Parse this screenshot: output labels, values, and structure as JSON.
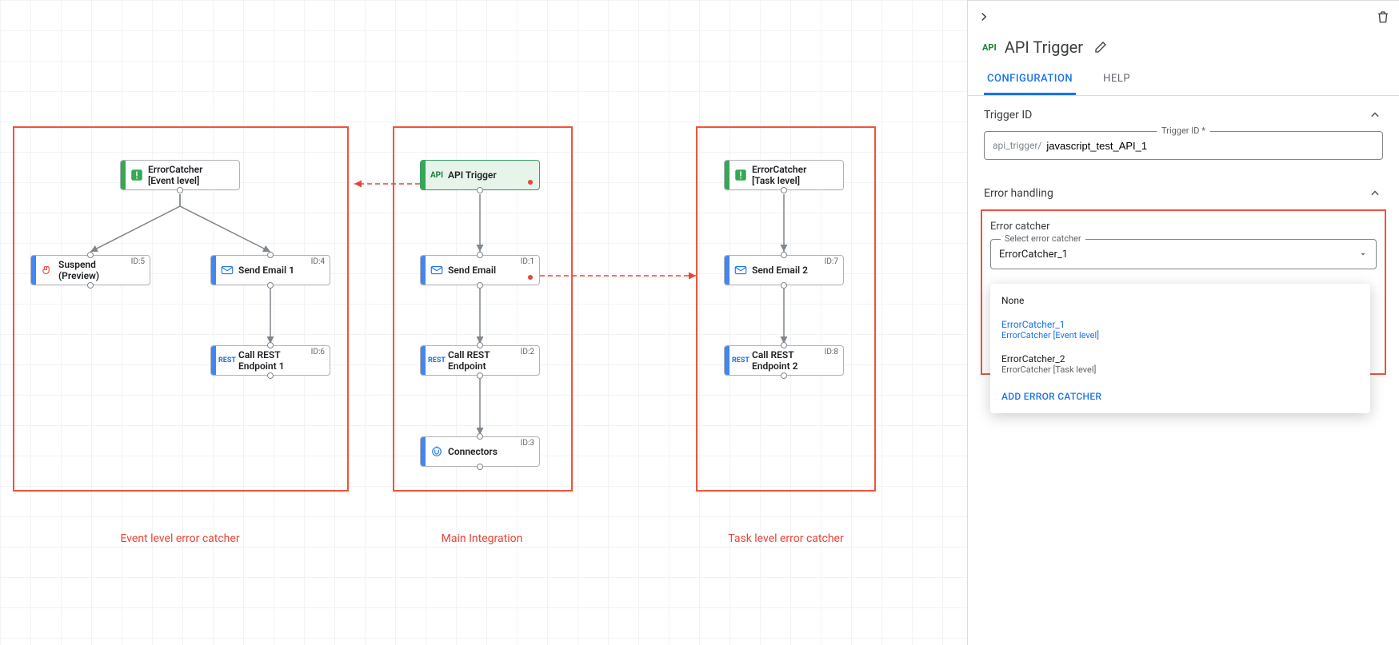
{
  "regions": {
    "event": {
      "label": "Event level error catcher"
    },
    "main": {
      "label": "Main Integration"
    },
    "task": {
      "label": "Task level error catcher"
    }
  },
  "nodes": {
    "errEvent": {
      "label": "ErrorCatcher\n[Event level]"
    },
    "suspend": {
      "label": "Suspend\n(Preview)",
      "id": "ID:5"
    },
    "sendEmail1": {
      "label": "Send Email 1",
      "id": "ID:4"
    },
    "rest1": {
      "label": "Call REST\nEndpoint 1",
      "id": "ID:6"
    },
    "apiTrigger": {
      "label": "API Trigger"
    },
    "sendEmail": {
      "label": "Send Email",
      "id": "ID:1"
    },
    "rest": {
      "label": "Call REST\nEndpoint",
      "id": "ID:2"
    },
    "connectors": {
      "label": "Connectors",
      "id": "ID:3"
    },
    "errTask": {
      "label": "ErrorCatcher\n[Task level]"
    },
    "sendEmail2": {
      "label": "Send Email 2",
      "id": "ID:7"
    },
    "rest2": {
      "label": "Call REST\nEndpoint 2",
      "id": "ID:8"
    }
  },
  "panel": {
    "title": "API Trigger",
    "tabs": {
      "config": "CONFIGURATION",
      "help": "HELP"
    },
    "sections": {
      "triggerId": {
        "header": "Trigger ID",
        "field_label": "Trigger ID *",
        "prefix": "api_trigger/",
        "value": "javascript_test_API_1"
      },
      "errorHandling": {
        "header": "Error handling",
        "box_header": "Error catcher",
        "select_label": "Select error catcher",
        "select_value": "ErrorCatcher_1",
        "options": {
          "none": "None",
          "ec1_main": "ErrorCatcher_1",
          "ec1_sub": "ErrorCatcher [Event level]",
          "ec2_main": "ErrorCatcher_2",
          "ec2_sub": "ErrorCatcher [Task level]",
          "add": "ADD ERROR CATCHER"
        }
      }
    }
  }
}
